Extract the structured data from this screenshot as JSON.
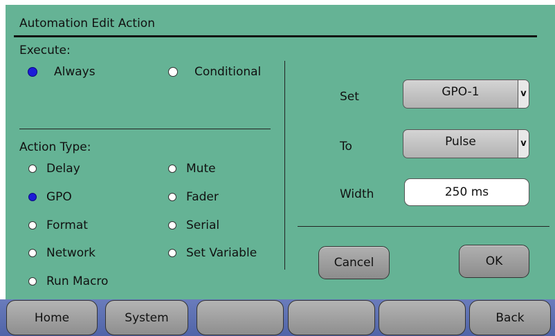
{
  "dialog": {
    "title": "Automation Edit Action"
  },
  "execute": {
    "label": "Execute:",
    "options": [
      {
        "label": "Always",
        "selected": true
      },
      {
        "label": "Conditional",
        "selected": false
      }
    ]
  },
  "action_type": {
    "label": "Action Type:",
    "options": [
      {
        "label": "Delay",
        "selected": false
      },
      {
        "label": "Mute",
        "selected": false
      },
      {
        "label": "GPO",
        "selected": true
      },
      {
        "label": "Fader",
        "selected": false
      },
      {
        "label": "Format",
        "selected": false
      },
      {
        "label": "Serial",
        "selected": false
      },
      {
        "label": "Network",
        "selected": false
      },
      {
        "label": "Set Variable",
        "selected": false
      },
      {
        "label": "Run Macro",
        "selected": false
      }
    ]
  },
  "settings": {
    "set": {
      "label": "Set",
      "value": "GPO-1",
      "arrow": "v"
    },
    "to": {
      "label": "To",
      "value": "Pulse",
      "arrow": "v"
    },
    "width": {
      "label": "Width",
      "value": "250 ms"
    }
  },
  "buttons": {
    "cancel": "Cancel",
    "ok": "OK"
  },
  "nav": {
    "home": "Home",
    "system": "System",
    "blank1": "",
    "blank2": "",
    "blank3": "",
    "back": "Back"
  },
  "colors": {
    "background": "#65b395",
    "selected_radio": "#1c1cd8",
    "navbar": "#5a6db3"
  }
}
